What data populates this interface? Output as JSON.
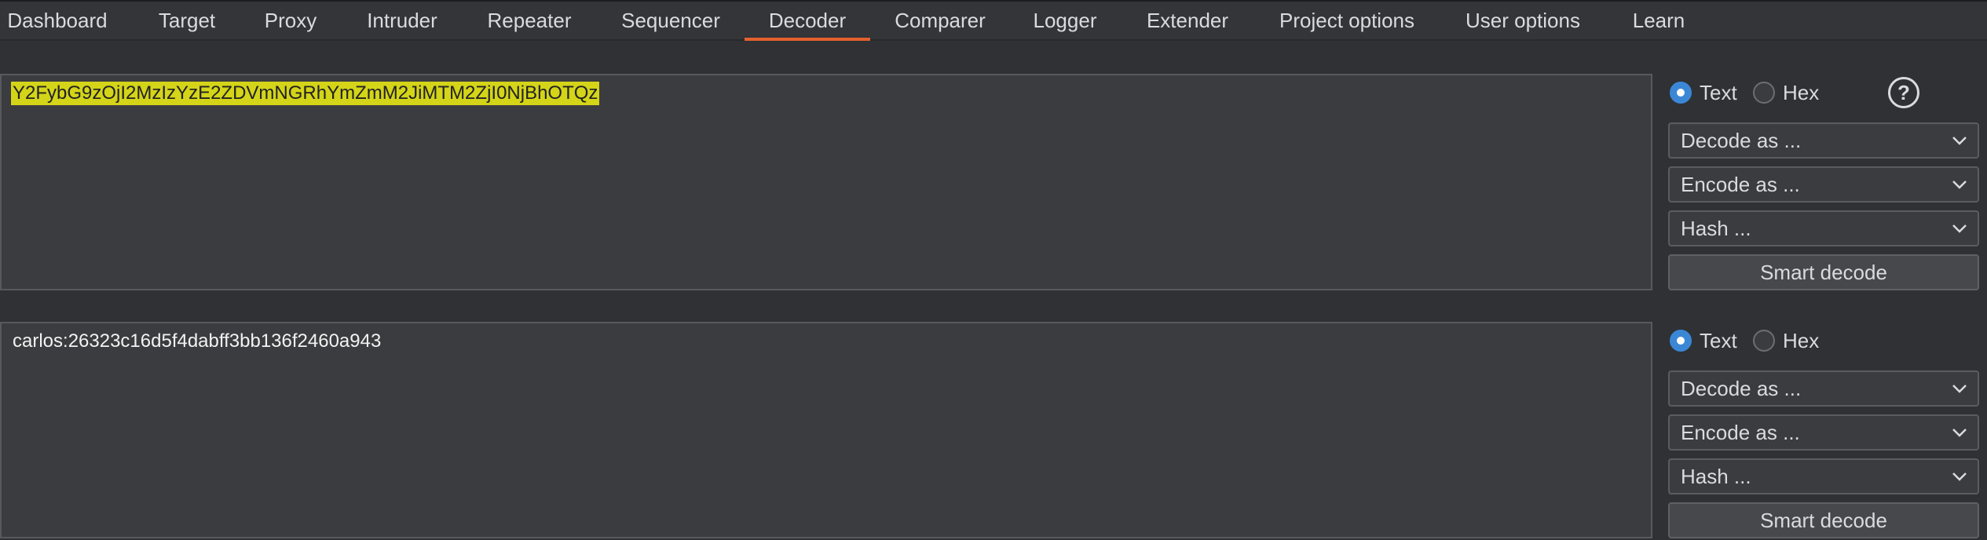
{
  "tabs": [
    {
      "label": "Dashboard",
      "active": false
    },
    {
      "label": "Target",
      "active": false
    },
    {
      "label": "Proxy",
      "active": false
    },
    {
      "label": "Intruder",
      "active": false
    },
    {
      "label": "Repeater",
      "active": false
    },
    {
      "label": "Sequencer",
      "active": false
    },
    {
      "label": "Decoder",
      "active": true
    },
    {
      "label": "Comparer",
      "active": false
    },
    {
      "label": "Logger",
      "active": false
    },
    {
      "label": "Extender",
      "active": false
    },
    {
      "label": "Project options",
      "active": false
    },
    {
      "label": "User options",
      "active": false
    },
    {
      "label": "Learn",
      "active": false
    }
  ],
  "colors": {
    "active_tab_underline": "#e4602e",
    "selection_highlight": "#d4d419",
    "radio_checked": "#3b87d6"
  },
  "panels": [
    {
      "text": "Y2FybG9zOjI2MzIzYzE2ZDVmNGRhYmZmM2JiMTM2ZjI0NjBhOTQz",
      "selected": true,
      "radio_text": "Text",
      "radio_hex": "Hex",
      "selected_format": "Text",
      "decode_label": "Decode as ...",
      "encode_label": "Encode as ...",
      "hash_label": "Hash ...",
      "smart_decode_label": "Smart decode",
      "help_icon": "?"
    },
    {
      "text": "carlos:26323c16d5f4dabff3bb136f2460a943",
      "selected": false,
      "radio_text": "Text",
      "radio_hex": "Hex",
      "selected_format": "Text",
      "decode_label": "Decode as ...",
      "encode_label": "Encode as ...",
      "hash_label": "Hash ...",
      "smart_decode_label": "Smart decode"
    }
  ]
}
